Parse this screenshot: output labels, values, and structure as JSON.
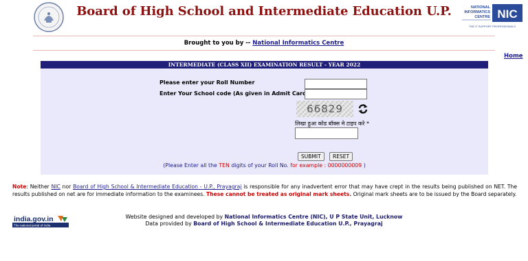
{
  "header": {
    "title": "Board of High School and Intermediate Education U.P.",
    "brought_prefix": "Brought to you by --",
    "brought_link": "National Informatics Centre",
    "home_link": "Home",
    "nic_logo_lines": [
      "NATIONAL",
      "INFORMATICS",
      "CENTRE"
    ],
    "nic_logo_mark": "NIC",
    "nic_logo_tagline": "THE IT SUPPORT PROFESSIONALS"
  },
  "form": {
    "title": "INTERMEDIATE (CLASS XII)  EXAMINATION RESULT - YEAR 2022",
    "roll_label": "Please enter your Roll Number",
    "school_label": "Enter Your School code (As given in Admit Card)",
    "roll_value": "",
    "school_value": "",
    "captcha_text": "66829",
    "captcha_hint": "लिखा हुआ कोड बॉक्स मे टाइप करे *",
    "captcha_value": "",
    "submit_label": "SUBMIT",
    "reset_label": "RESET",
    "note_prefix": "(Please Enter all the",
    "note_ten": "TEN",
    "note_mid": "digits of your Roll No.",
    "note_example": "for example : 0000000009",
    "note_suffix": ")"
  },
  "footer": {
    "note_label": "Note",
    "note_part1": ": Neither",
    "note_nic": "NIC",
    "note_part2": "nor",
    "note_board": "Board of High School & Intermediate Education - U.P., Prayagraj",
    "note_part3": "is responsible for any inadvertent error that may have crept in the results being published on NET. The results published on net are for immediate information to the examinees.",
    "note_warning": "These cannot be treated as original mark sheets.",
    "note_part4": "Original mark sheets are to be issued by the Board separately.",
    "indiagov_text": "india.gov.in",
    "indiagov_sub": "The national portal of India",
    "credits_line1_prefix": "Website designed and developed by",
    "credits_line1_bold": "National Informatics Centre (NIC), U P State Unit, Lucknow",
    "credits_line2_prefix": "Data provided by",
    "credits_line2_bold": "Board of High School & Intermediate Education U.P., Prayagraj"
  },
  "colors": {
    "title_red": "#8b1111",
    "panel_bg": "#e9e9fb",
    "panel_header": "#1f1f7a",
    "link_blue": "#1a1a8c",
    "warn_red": "#cc0000"
  }
}
